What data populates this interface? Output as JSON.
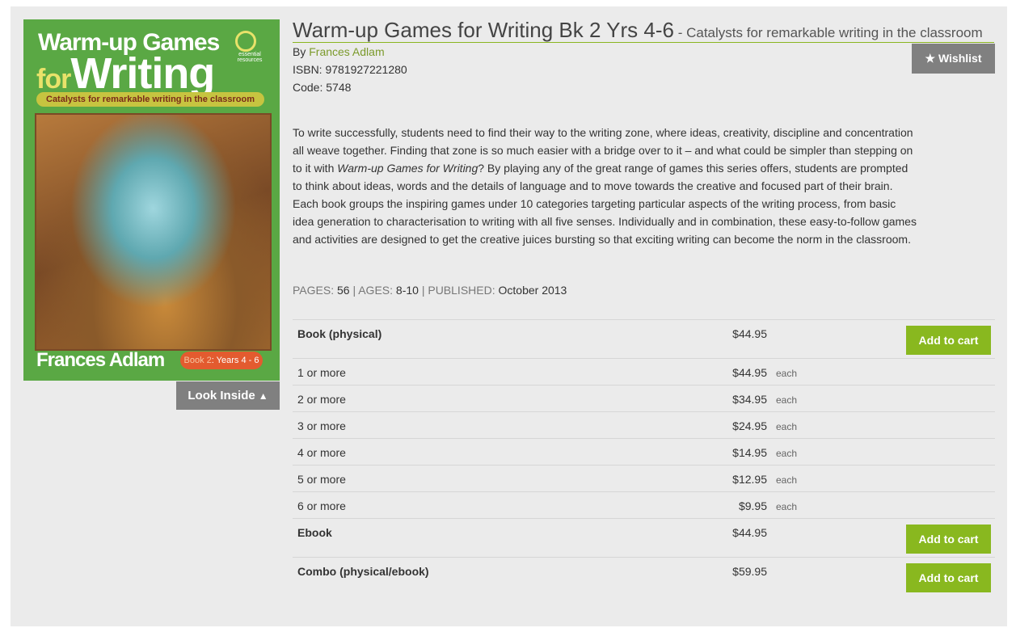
{
  "cover": {
    "title_line1": "Warm-up Games",
    "title_for": "for",
    "title_line2": "Writing",
    "subtitle": "Catalysts for remarkable writing in the classroom",
    "logo_text": "essential resources",
    "author": "Frances Adlam",
    "badge_book": "Book 2",
    "badge_years": ": Years 4 - 6"
  },
  "look_inside": "Look Inside",
  "product": {
    "title": "Warm-up Games for Writing Bk 2 Yrs 4-6",
    "subtitle": " - Catalysts for remarkable writing in the classroom",
    "by_label": "By ",
    "author": "Frances Adlam",
    "isbn": "ISBN: 9781927221280",
    "code": "Code: 5748",
    "wishlist": "Wishlist",
    "description_1": "To write successfully, students need to find their way to the writing zone, where ideas, creativity, discipline and concentration all weave together. Finding that zone is so much easier with a bridge over to it – and what could be simpler than stepping on to it with ",
    "description_italic": "Warm-up Games for Writing",
    "description_2": "? By playing any of the great range of games this series offers, students are prompted to think about ideas, words and the details of language and to move towards the creative and focused part of their brain. Each book groups the inspiring games under 10 categories targeting particular aspects of the writing process, from basic idea generation to characterisation to writing with all five senses. Individually and in combination, these easy-to-follow games and activities are designed to get the creative juices bursting so that exciting writing can become the norm in the classroom.",
    "pages_label": "PAGES:",
    "pages": "56",
    "ages_label": "AGES:",
    "ages": "8-10",
    "published_label": "PUBLISHED:",
    "published": "October 2013",
    "sep": "|"
  },
  "pricing": {
    "add_to_cart": "Add to cart",
    "each": "each",
    "book": {
      "label": "Book (physical)",
      "price": "$44.95"
    },
    "tiers": [
      {
        "label": "1 or more",
        "price": "$44.95"
      },
      {
        "label": "2 or more",
        "price": "$34.95"
      },
      {
        "label": "3 or more",
        "price": "$24.95"
      },
      {
        "label": "4 or more",
        "price": "$14.95"
      },
      {
        "label": "5 or more",
        "price": "$12.95"
      },
      {
        "label": "6 or more",
        "price": "$9.95"
      }
    ],
    "ebook": {
      "label": "Ebook",
      "price": "$44.95"
    },
    "combo": {
      "label": "Combo (physical/ebook)",
      "price": "$59.95"
    }
  },
  "icons": {
    "wishlist": "star-icon",
    "look_inside": "chevron-up-icon"
  },
  "colors": {
    "accent_green": "#89b81f",
    "author_link": "#7b9a2b",
    "button_gray": "#808080"
  }
}
